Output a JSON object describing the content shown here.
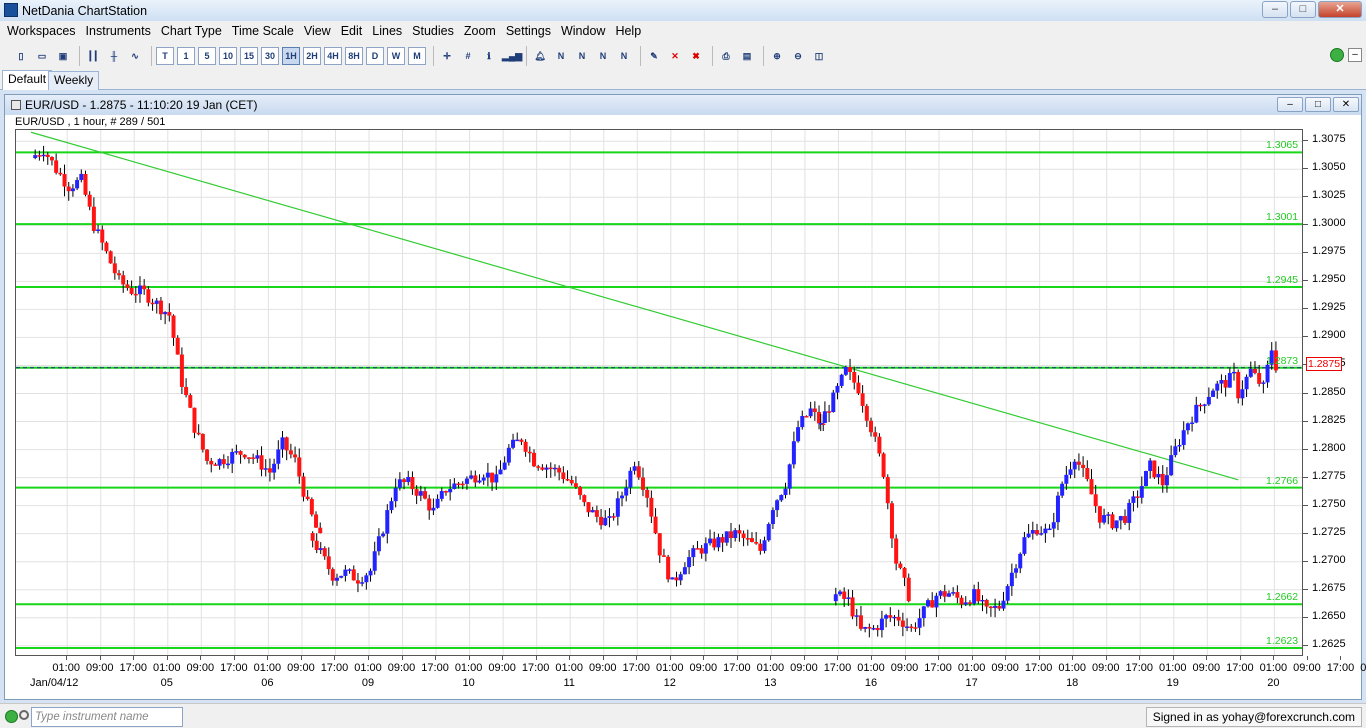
{
  "app": {
    "title": "NetDania ChartStation",
    "window_buttons": [
      "–",
      "□",
      "✕"
    ]
  },
  "menu": [
    "Workspaces",
    "Instruments",
    "Chart Type",
    "Time Scale",
    "View",
    "Edit",
    "Lines",
    "Studies",
    "Zoom",
    "Settings",
    "Window",
    "Help"
  ],
  "toolbar": {
    "timeframes": [
      "T",
      "1",
      "5",
      "10",
      "15",
      "30",
      "1H",
      "2H",
      "4H",
      "8H",
      "D",
      "W",
      "M"
    ],
    "active_timeframe": "1H",
    "icons": [
      "new-icon",
      "open-icon",
      "save-icon",
      "bar-chart-icon",
      "candlestick-icon",
      "line-chart-icon",
      "crosshair-icon",
      "grid-icon",
      "info-icon",
      "volume-icon",
      "alert-bell-icon",
      "fibonacci-icon",
      "delete-line-icon",
      "print-icon",
      "print-preview-icon",
      "zoom-in-icon",
      "zoom-out-icon",
      "zoom-reset-icon"
    ]
  },
  "tabs": [
    "Default",
    "Weekly"
  ],
  "chart": {
    "window_title": "EUR/USD - 1.2875 - 11:10:20  19 Jan (CET)",
    "info": "EUR/USD , 1 hour, # 289 / 501",
    "current_price_label": "1.2875",
    "colors": {
      "up": "#2323ff",
      "down": "#ff1414",
      "level": "#18d618",
      "trend": "#33cc33",
      "grid": "#e2e2e2"
    }
  },
  "chart_data": {
    "type": "candlestick",
    "instrument": "EUR/USD",
    "timeframe": "1 hour",
    "ylim": [
      1.2615,
      1.3085
    ],
    "y_ticks": [
      "1.3075",
      "1.3050",
      "1.3025",
      "1.3000",
      "1.2975",
      "1.2950",
      "1.2925",
      "1.2900",
      "1.2875",
      "1.2850",
      "1.2825",
      "1.2800",
      "1.2775",
      "1.2750",
      "1.2725",
      "1.2700",
      "1.2675",
      "1.2650",
      "1.2625"
    ],
    "x_tick_labels": [
      "01:00",
      "09:00",
      "17:00",
      "01:00",
      "09:00",
      "17:00",
      "01:00",
      "09:00",
      "17:00",
      "01:00",
      "09:00",
      "17:00",
      "01:00",
      "09:00",
      "17:00",
      "01:00",
      "09:00",
      "17:00",
      "01:00",
      "09:00",
      "17:00",
      "01:00",
      "09:00",
      "17:00",
      "01:00",
      "09:00",
      "17:00",
      "01:00",
      "09:00",
      "17:00",
      "01:00",
      "09:00",
      "17:00",
      "01:00",
      "09:00",
      "17:00",
      "01:00",
      "09:00",
      "17:00",
      "01:00"
    ],
    "x_date_labels": [
      "Jan/04/12",
      "05",
      "06",
      "09",
      "10",
      "11",
      "12",
      "13",
      "16",
      "17",
      "18",
      "19",
      "20"
    ],
    "horizontal_levels": [
      {
        "label": "1.3065",
        "value": 1.3065
      },
      {
        "label": "1.3001",
        "value": 1.3001
      },
      {
        "label": "1.2945",
        "value": 1.2945
      },
      {
        "label": "1.2873",
        "value": 1.2873
      },
      {
        "label": "1.2766",
        "value": 1.2766
      },
      {
        "label": "1.2662",
        "value": 1.2662
      },
      {
        "label": "1.2623",
        "value": 1.2623
      }
    ],
    "trendline": {
      "start": {
        "x": "Jan/04/12 00:00",
        "y": 1.3083
      },
      "end": {
        "x": "Jan/20/12 00:00",
        "y": 1.2773
      }
    },
    "close_path": [
      [
        "Jan/04/12 00:00",
        1.306
      ],
      [
        "Jan/04/12 03:00",
        1.3068
      ],
      [
        "Jan/04/12 06:00",
        1.305
      ],
      [
        "Jan/04/12 09:00",
        1.3035
      ],
      [
        "Jan/04/12 12:00",
        1.304
      ],
      [
        "Jan/04/12 15:00",
        1.3
      ],
      [
        "Jan/04/12 18:00",
        1.2975
      ],
      [
        "Jan/04/12 21:00",
        1.295
      ],
      [
        "Jan/05/12 00:00",
        1.2942
      ],
      [
        "Jan/05/12 03:00",
        1.294
      ],
      [
        "Jan/05/12 06:00",
        1.293
      ],
      [
        "Jan/05/12 09:00",
        1.292
      ],
      [
        "Jan/05/12 12:00",
        1.286
      ],
      [
        "Jan/05/12 15:00",
        1.282
      ],
      [
        "Jan/05/12 18:00",
        1.279
      ],
      [
        "Jan/05/12 21:00",
        1.279
      ],
      [
        "Jan/06/12 00:00",
        1.2795
      ],
      [
        "Jan/06/12 03:00",
        1.2798
      ],
      [
        "Jan/06/12 06:00",
        1.279
      ],
      [
        "Jan/06/12 09:00",
        1.278
      ],
      [
        "Jan/06/12 12:00",
        1.2805
      ],
      [
        "Jan/06/12 15:00",
        1.279
      ],
      [
        "Jan/06/12 18:00",
        1.275
      ],
      [
        "Jan/06/12 21:00",
        1.272
      ],
      [
        "Jan/07/12 00:00",
        1.272
      ],
      [
        "Jan/09/12 00:00",
        1.2688
      ],
      [
        "Jan/09/12 03:00",
        1.269
      ],
      [
        "Jan/09/12 06:00",
        1.2685
      ],
      [
        "Jan/09/12 09:00",
        1.2692
      ],
      [
        "Jan/09/12 12:00",
        1.273
      ],
      [
        "Jan/09/12 15:00",
        1.277
      ],
      [
        "Jan/09/12 18:00",
        1.277
      ],
      [
        "Jan/09/12 21:00",
        1.276
      ],
      [
        "Jan/10/12 00:00",
        1.2745
      ],
      [
        "Jan/10/12 03:00",
        1.2765
      ],
      [
        "Jan/10/12 06:00",
        1.277
      ],
      [
        "Jan/10/12 09:00",
        1.2775
      ],
      [
        "Jan/10/12 12:00",
        1.278
      ],
      [
        "Jan/10/12 15:00",
        1.2772
      ],
      [
        "Jan/10/12 18:00",
        1.28
      ],
      [
        "Jan/10/12 21:00",
        1.281
      ],
      [
        "Jan/11/12 00:00",
        1.279
      ],
      [
        "Jan/11/12 03:00",
        1.2785
      ],
      [
        "Jan/11/12 06:00",
        1.278
      ],
      [
        "Jan/11/12 09:00",
        1.277
      ],
      [
        "Jan/11/12 12:00",
        1.275
      ],
      [
        "Jan/11/12 15:00",
        1.274
      ],
      [
        "Jan/11/12 18:00",
        1.2735
      ],
      [
        "Jan/11/12 21:00",
        1.276
      ],
      [
        "Jan/12/12 00:00",
        1.279
      ],
      [
        "Jan/12/12 03:00",
        1.276
      ],
      [
        "Jan/12/12 06:00",
        1.271
      ],
      [
        "Jan/12/12 09:00",
        1.268
      ],
      [
        "Jan/12/12 12:00",
        1.27
      ],
      [
        "Jan/12/12 15:00",
        1.271
      ],
      [
        "Jan/12/12 18:00",
        1.2715
      ],
      [
        "Jan/12/12 21:00",
        1.272
      ],
      [
        "Jan/13/12 00:00",
        1.2725
      ],
      [
        "Jan/13/12 03:00",
        1.2718
      ],
      [
        "Jan/13/12 06:00",
        1.271
      ],
      [
        "Jan/13/12 09:00",
        1.275
      ],
      [
        "Jan/13/12 12:00",
        1.277
      ],
      [
        "Jan/13/12 15:00",
        1.282
      ],
      [
        "Jan/13/12 18:00",
        1.2835
      ],
      [
        "Jan/13/12 21:00",
        1.282
      ],
      [
        "Jan/14/12 00:00",
        1.2825
      ],
      [
        "Jan/14/12 03:00",
        1.2845
      ],
      [
        "Jan/14/12 06:00",
        1.287
      ],
      [
        "Jan/14/12 09:00",
        1.2855
      ],
      [
        "Jan/14/12 12:00",
        1.282
      ],
      [
        "Jan/14/12 15:00",
        1.278
      ],
      [
        "Jan/14/12 18:00",
        1.27
      ],
      [
        "Jan/14/12 21:00",
        1.267
      ],
      [
        "Jan/16/12 00:00",
        1.267
      ],
      [
        "Jan/16/12 03:00",
        1.2665
      ],
      [
        "Jan/16/12 06:00",
        1.2638
      ],
      [
        "Jan/16/12 09:00",
        1.264
      ],
      [
        "Jan/16/12 12:00",
        1.265
      ],
      [
        "Jan/16/12 15:00",
        1.265
      ],
      [
        "Jan/16/12 18:00",
        1.264
      ],
      [
        "Jan/16/12 21:00",
        1.2655
      ],
      [
        "Jan/17/12 00:00",
        1.267
      ],
      [
        "Jan/17/12 03:00",
        1.2672
      ],
      [
        "Jan/17/12 06:00",
        1.2665
      ],
      [
        "Jan/17/12 09:00",
        1.267
      ],
      [
        "Jan/17/12 12:00",
        1.2655
      ],
      [
        "Jan/17/12 15:00",
        1.266
      ],
      [
        "Jan/17/12 18:00",
        1.269
      ],
      [
        "Jan/17/12 21:00",
        1.272
      ],
      [
        "Jan/18/12 00:00",
        1.273
      ],
      [
        "Jan/18/12 03:00",
        1.2725
      ],
      [
        "Jan/18/12 06:00",
        1.277
      ],
      [
        "Jan/18/12 09:00",
        1.2795
      ],
      [
        "Jan/18/12 12:00",
        1.277
      ],
      [
        "Jan/18/12 15:00",
        1.274
      ],
      [
        "Jan/18/12 18:00",
        1.2735
      ],
      [
        "Jan/18/12 21:00",
        1.274
      ],
      [
        "Jan/19/12 00:00",
        1.276
      ],
      [
        "Jan/19/12 03:00",
        1.2785
      ],
      [
        "Jan/19/12 06:00",
        1.277
      ],
      [
        "Jan/19/12 09:00",
        1.28
      ],
      [
        "Jan/19/12 12:00",
        1.2825
      ],
      [
        "Jan/19/12 15:00",
        1.284
      ],
      [
        "Jan/19/12 18:00",
        1.2855
      ],
      [
        "Jan/19/12 21:00",
        1.286
      ],
      [
        "Jan/19/12 23:00",
        1.2865
      ],
      [
        "Jan/20/12 00:00",
        1.285
      ],
      [
        "Jan/20/12 03:00",
        1.287
      ],
      [
        "Jan/20/12 06:00",
        1.2855
      ],
      [
        "Jan/20/12 08:00",
        1.289
      ],
      [
        "Jan/20/12 09:00",
        1.2875
      ]
    ]
  },
  "status": {
    "search_placeholder": "Type instrument name",
    "signed_in": "Signed in as yohay@forexcrunch.com"
  }
}
